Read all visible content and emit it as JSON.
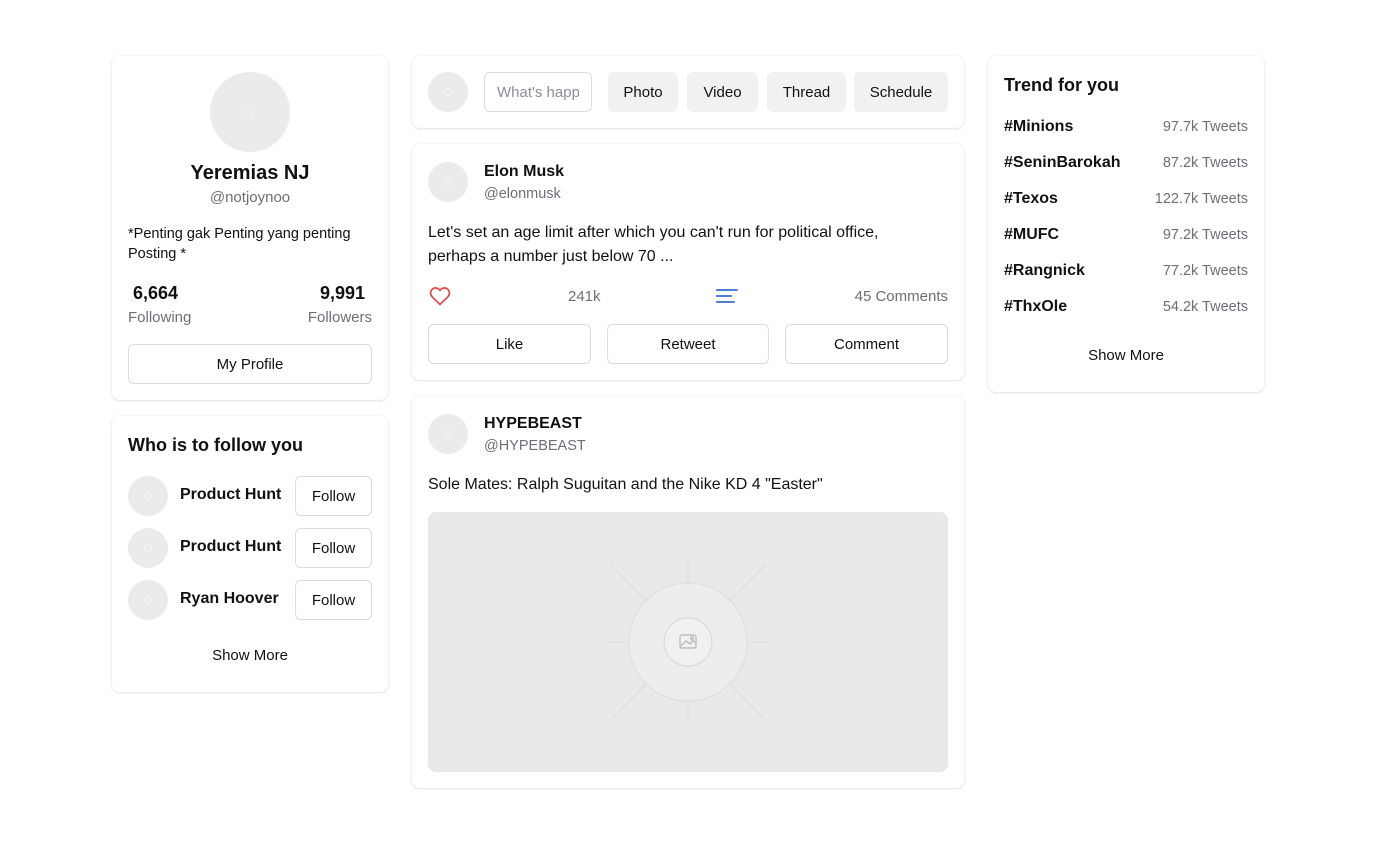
{
  "profile": {
    "name": "Yeremias NJ",
    "handle": "@notjoynoo",
    "bio": "*Penting gak Penting yang penting Posting *",
    "following_count": "6,664",
    "following_label": "Following",
    "followers_count": "9,991",
    "followers_label": "Followers",
    "my_profile_label": "My Profile"
  },
  "follow": {
    "title": "Who is to follow you",
    "items": [
      {
        "name": "Product Hunt",
        "button": "Follow"
      },
      {
        "name": "Product Hunt",
        "button": "Follow"
      },
      {
        "name": "Ryan Hoover",
        "button": "Follow"
      }
    ],
    "show_more": "Show More"
  },
  "composer": {
    "placeholder": "What's happening?",
    "buttons": [
      "Photo",
      "Video",
      "Thread",
      "Schedule"
    ]
  },
  "posts": [
    {
      "author": "Elon Musk",
      "handle": "@elonmusk",
      "text": "Let's set an age limit after which you can't run for political office, perhaps a number just below 70 ...",
      "likes": "241k",
      "comments": "45 Comments",
      "actions": [
        "Like",
        "Retweet",
        "Comment"
      ]
    },
    {
      "author": "HYPEBEAST",
      "handle": "@HYPEBEAST",
      "text": "Sole Mates: Ralph Suguitan and the Nike KD 4 \"Easter\""
    }
  ],
  "trends": {
    "title": "Trend for you",
    "items": [
      {
        "tag": "#Minions",
        "count": "97.7k Tweets"
      },
      {
        "tag": "#SeninBarokah",
        "count": "87.2k Tweets"
      },
      {
        "tag": "#Texos",
        "count": "122.7k Tweets"
      },
      {
        "tag": "#MUFC",
        "count": "97.2k Tweets"
      },
      {
        "tag": "#Rangnick",
        "count": "77.2k Tweets"
      },
      {
        "tag": "#ThxOle",
        "count": "54.2k Tweets"
      }
    ],
    "show_more": "Show More"
  },
  "icons": {
    "like": "heart-icon",
    "comments": "lines-icon",
    "media": "image-placeholder-icon"
  },
  "colors": {
    "heart": "#e05252",
    "lines": "#4a7fd4"
  }
}
